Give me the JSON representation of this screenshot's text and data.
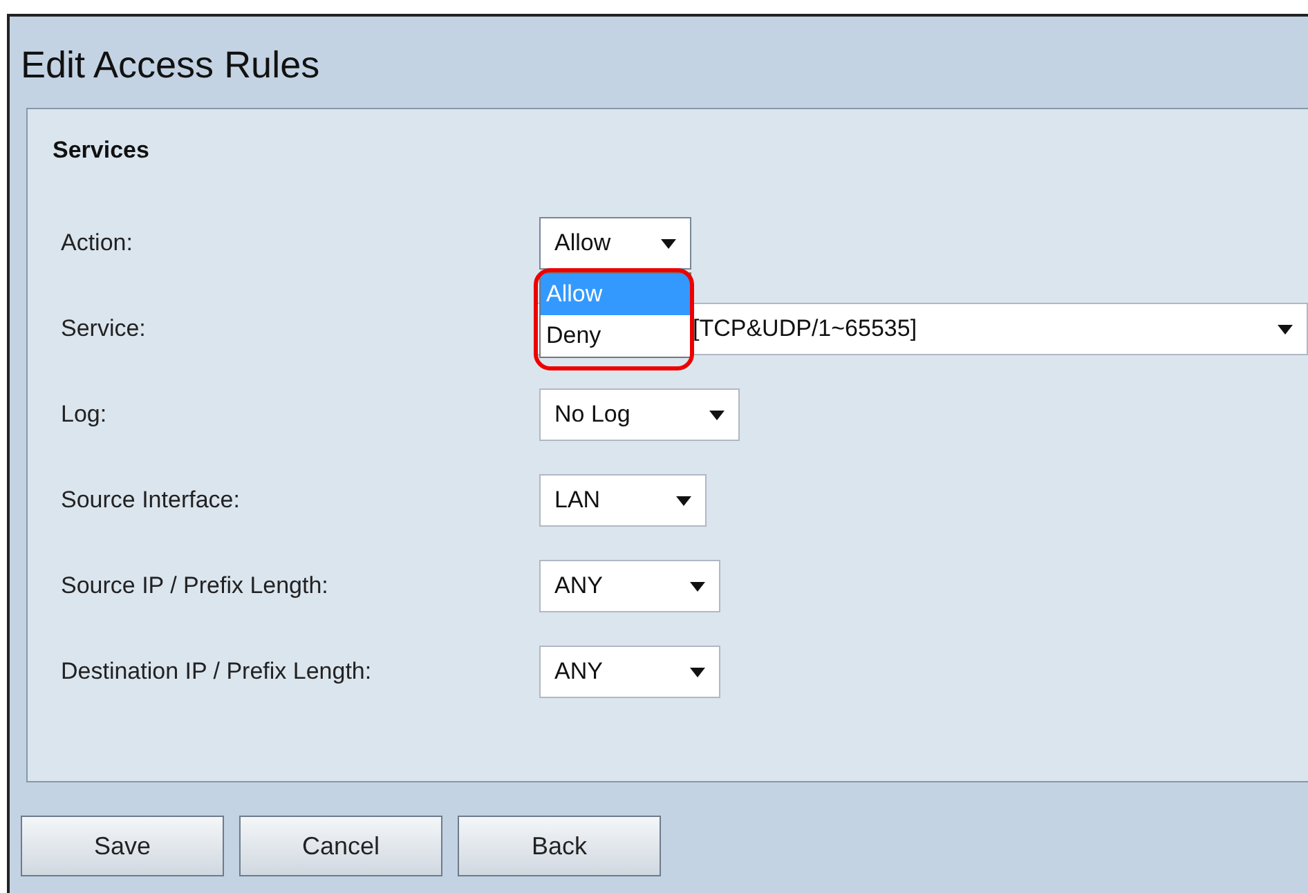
{
  "window": {
    "title": "Edit Access Rules"
  },
  "section": {
    "title": "Services"
  },
  "fields": [
    {
      "label": "Action:",
      "value": "Allow",
      "open": true,
      "options": [
        {
          "label": "Allow",
          "selected": true
        },
        {
          "label": "Deny",
          "selected": false
        }
      ]
    },
    {
      "label": "Service:",
      "value": "[TCP&UDP/1~65535]",
      "open": false
    },
    {
      "label": "Log:",
      "value": "No Log",
      "open": false
    },
    {
      "label": "Source Interface:",
      "value": "LAN",
      "open": false
    },
    {
      "label": "Source IP / Prefix Length:",
      "value": "ANY",
      "open": false
    },
    {
      "label": "Destination IP / Prefix Length:",
      "value": "ANY",
      "open": false
    }
  ],
  "buttons": [
    "Save",
    "Cancel",
    "Back"
  ]
}
